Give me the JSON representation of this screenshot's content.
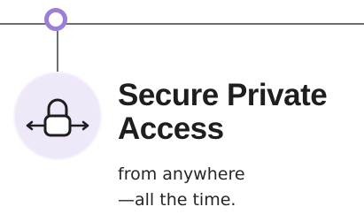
{
  "feature": {
    "title_line1": "Secure Private",
    "title_line2": "Access",
    "subtitle_line1": "from anywhere",
    "subtitle_line2": "—all the time.",
    "icon": "padlock-with-arrows-icon"
  },
  "colors": {
    "accent": "#9a7ed8",
    "badge_background": "#eee8f9",
    "line": "#6f6f6f",
    "title_text": "#1e1e1e"
  }
}
